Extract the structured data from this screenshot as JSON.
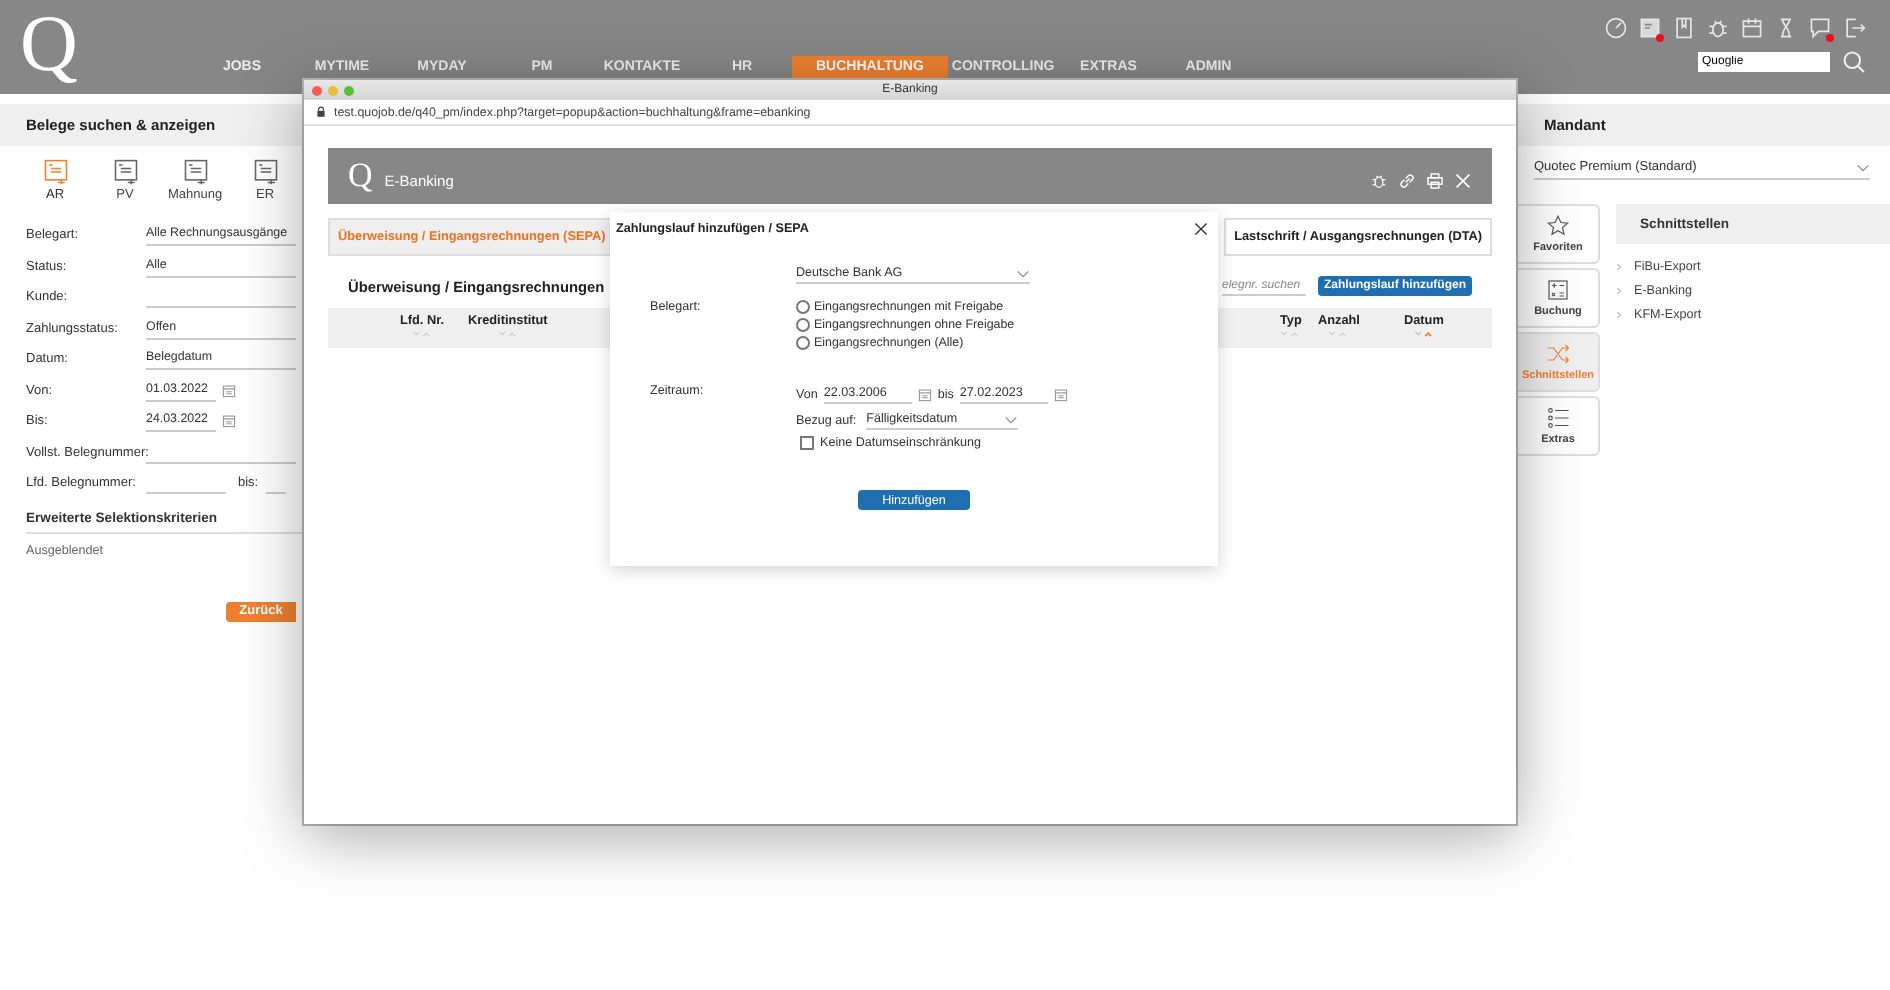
{
  "app": {
    "logo": "Q",
    "nav": [
      {
        "label": "JOBS",
        "selected": false
      },
      {
        "label": "MYTIME",
        "selected": false
      },
      {
        "label": "MYDAY",
        "selected": false
      },
      {
        "label": "PM",
        "selected": false
      },
      {
        "label": "KONTAKTE",
        "selected": false
      },
      {
        "label": "HR",
        "selected": false
      },
      {
        "label": "BUCHHALTUNG",
        "selected": true
      },
      {
        "label": "CONTROLLING",
        "selected": false
      },
      {
        "label": "EXTRAS",
        "selected": false
      },
      {
        "label": "ADMIN",
        "selected": false
      }
    ],
    "header_icons": [
      {
        "kind": "gauge",
        "alert": false
      },
      {
        "kind": "card",
        "alert": true
      },
      {
        "kind": "book",
        "alert": false
      },
      {
        "kind": "bug",
        "alert": false
      },
      {
        "kind": "calendar",
        "alert": false
      },
      {
        "kind": "hourglass",
        "alert": false
      },
      {
        "kind": "chat",
        "alert": true
      },
      {
        "kind": "logout",
        "alert": false
      }
    ],
    "search": {
      "value": "Quoglie"
    }
  },
  "left_panel": {
    "title": "Belege suchen & anzeigen",
    "doc_types": [
      {
        "label": "AR",
        "selected": true
      },
      {
        "label": "PV",
        "selected": false
      },
      {
        "label": "Mahnung",
        "selected": false
      },
      {
        "label": "ER",
        "selected": false
      }
    ],
    "fields": [
      {
        "kind": "select",
        "label": "Belegart:",
        "value": "Alle Rechnungsausgänge"
      },
      {
        "kind": "select",
        "label": "Status:",
        "value": "Alle"
      },
      {
        "kind": "text",
        "label": "Kunde:"
      },
      {
        "kind": "select",
        "label": "Zahlungsstatus:",
        "value": "Offen"
      },
      {
        "kind": "select",
        "label": "Datum:",
        "value": "Belegdatum"
      },
      {
        "kind": "date",
        "label": "Von:",
        "value": "01.03.2022"
      },
      {
        "kind": "date",
        "label": "Bis:",
        "value": "24.03.2022"
      },
      {
        "kind": "text",
        "label": "Vollst. Belegnummer:"
      },
      {
        "kind": "range",
        "label": "Lfd. Belegnummer:",
        "to_label": "bis:"
      }
    ],
    "section": "Erweiterte Selektionskriterien",
    "section_note": "Ausgeblendet",
    "button": "Zurück"
  },
  "right_panel": {
    "title": "Mandant",
    "client": "Quotec Premium (Standard)",
    "side_tabs": [
      {
        "kind": "star",
        "label": "Favoriten",
        "selected": false
      },
      {
        "kind": "calculator",
        "label": "Buchung",
        "selected": false
      },
      {
        "kind": "shuffle",
        "label": "Schnittstellen",
        "selected": true
      },
      {
        "kind": "list",
        "label": "Extras",
        "selected": false
      }
    ],
    "interfaces": {
      "title": "Schnittstellen",
      "items": [
        "FiBu-Export",
        "E-Banking",
        "KFM-Export"
      ]
    }
  },
  "popup": {
    "title": "E-Banking",
    "url": "test.quojob.de/q40_pm/index.php?target=popup&action=buchhaltung&frame=ebanking",
    "logo": "Q",
    "header_title": "E-Banking",
    "tabs": [
      {
        "label": "Überweisung / Eingangsrechnungen (SEPA)",
        "selected": true
      },
      {
        "label": "Lastschrift / Ausgangsrechnungen (DTA)",
        "selected": false
      }
    ],
    "heading": "Überweisung / Eingangsrechnungen",
    "search_placeholder": "elegnr. suchen",
    "add_button": "Zahlungslauf hinzufügen",
    "columns": [
      {
        "label": "Lfd. Nr.",
        "sorted": false
      },
      {
        "label": "Kreditinstitut",
        "sorted": false
      },
      {
        "label": "Typ",
        "sorted": false
      },
      {
        "label": "Anzahl",
        "sorted": false
      },
      {
        "label": "Datum",
        "sorted": true
      }
    ]
  },
  "dialog": {
    "title": "Zahlungslauf hinzufügen / SEPA",
    "bank": "Deutsche Bank AG",
    "belegart_label": "Belegart:",
    "options": [
      {
        "label": "Eingangsrechnungen mit Freigabe",
        "selected": false
      },
      {
        "label": "Eingangsrechnungen ohne Freigabe",
        "selected": false
      },
      {
        "label": "Eingangsrechnungen (Alle)",
        "selected": false
      }
    ],
    "zeitraum_label": "Zeitraum:",
    "from_label": "Von",
    "from": "22.03.2006",
    "to_label": "bis",
    "to": "27.02.2023",
    "ref_label": "Bezug auf:",
    "ref": "Fälligkeitsdatum",
    "no_limit": {
      "label": "Keine Datumseinschränkung",
      "checked": false
    },
    "submit": "Hinzufügen"
  }
}
